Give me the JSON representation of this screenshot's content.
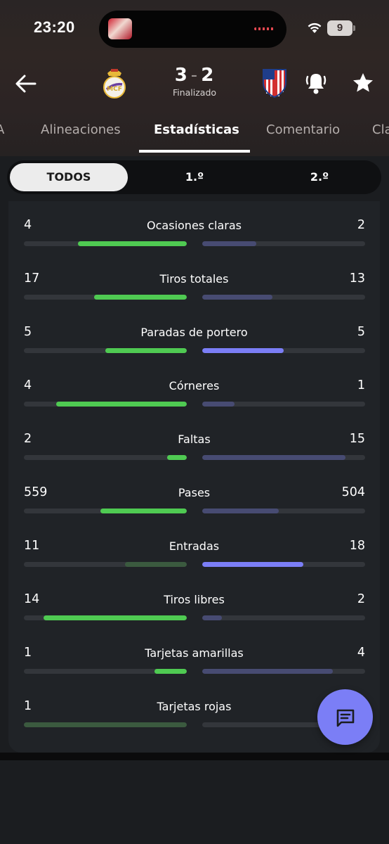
{
  "status_bar": {
    "time": "23:20",
    "battery": "9"
  },
  "match": {
    "home_score": "3",
    "separator": "-",
    "away_score": "2",
    "status": "Finalizado"
  },
  "tabs": [
    {
      "label": "A"
    },
    {
      "label": "Alineaciones"
    },
    {
      "label": "Estadísticas",
      "active": true
    },
    {
      "label": "Comentario"
    },
    {
      "label": "Cla"
    }
  ],
  "period_switch": [
    {
      "label": "TODOS",
      "active": true
    },
    {
      "label": "1.º"
    },
    {
      "label": "2.º"
    }
  ],
  "colors": {
    "home_strong": "#4fca52",
    "home_muted": "#3b5a3f",
    "away_strong": "#7b7ef6",
    "away_muted": "#474b72",
    "track": "#33363b"
  },
  "stats": [
    {
      "label": "Ocasiones claras",
      "home": "4",
      "away": "2",
      "home_fill": 0.67,
      "away_fill": 0.33,
      "home_style": "strong",
      "away_style": "muted"
    },
    {
      "label": "Tiros totales",
      "home": "17",
      "away": "13",
      "home_fill": 0.57,
      "away_fill": 0.43,
      "home_style": "strong",
      "away_style": "muted"
    },
    {
      "label": "Paradas de portero",
      "home": "5",
      "away": "5",
      "home_fill": 0.5,
      "away_fill": 0.5,
      "home_style": "strong",
      "away_style": "strong"
    },
    {
      "label": "Córneres",
      "home": "4",
      "away": "1",
      "home_fill": 0.8,
      "away_fill": 0.2,
      "home_style": "strong",
      "away_style": "muted"
    },
    {
      "label": "Faltas",
      "home": "2",
      "away": "15",
      "home_fill": 0.12,
      "away_fill": 0.88,
      "home_style": "strong",
      "away_style": "muted"
    },
    {
      "label": "Pases",
      "home": "559",
      "away": "504",
      "home_fill": 0.53,
      "away_fill": 0.47,
      "home_style": "strong",
      "away_style": "muted"
    },
    {
      "label": "Entradas",
      "home": "11",
      "away": "18",
      "home_fill": 0.38,
      "away_fill": 0.62,
      "home_style": "muted",
      "away_style": "strong"
    },
    {
      "label": "Tiros libres",
      "home": "14",
      "away": "2",
      "home_fill": 0.88,
      "away_fill": 0.12,
      "home_style": "strong",
      "away_style": "muted"
    },
    {
      "label": "Tarjetas amarillas",
      "home": "1",
      "away": "4",
      "home_fill": 0.2,
      "away_fill": 0.8,
      "home_style": "strong",
      "away_style": "muted"
    },
    {
      "label": "Tarjetas rojas",
      "home": "1",
      "away": "",
      "home_fill": 1.0,
      "away_fill": 0.0,
      "home_style": "muted",
      "away_style": "muted"
    }
  ],
  "icons": {
    "back": "arrow-left-icon",
    "home_crest": "real-madrid-crest",
    "away_crest": "atletico-madrid-crest",
    "bell": "bell-ringing-icon",
    "star": "star-icon",
    "fab": "chat-icon"
  }
}
